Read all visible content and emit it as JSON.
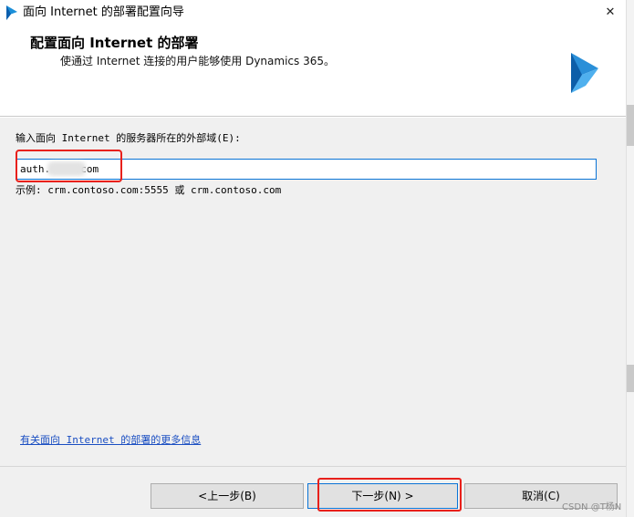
{
  "window": {
    "title": "面向 Internet 的部署配置向导",
    "close_glyph": "✕"
  },
  "header": {
    "title": "配置面向 Internet 的部署",
    "subtitle": "使通过 Internet 连接的用户能够使用 Dynamics 365。"
  },
  "form": {
    "domain_label": "输入面向 Internet 的服务器所在的外部域(E):",
    "domain_value": "auth.    .com",
    "example": "示例: crm.contoso.com:5555 或 crm.contoso.com"
  },
  "links": {
    "more_info": "有关面向 Internet 的部署的更多信息"
  },
  "buttons": {
    "back": "<上一步(B)",
    "next": "下一步(N) >",
    "cancel": "取消(C)"
  },
  "watermark": "CSDN @T杨N",
  "colors": {
    "accent": "#0a74d6",
    "highlight": "#e8201b",
    "link": "#1a4ec2"
  }
}
